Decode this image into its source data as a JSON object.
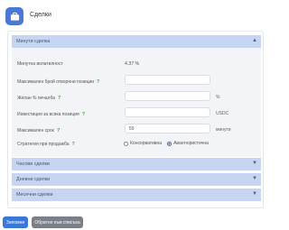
{
  "header": {
    "title": "Сделки"
  },
  "sections": {
    "closed": {
      "title": "Минути сделка"
    },
    "hourly": {
      "title": "Часови сделки"
    },
    "daily": {
      "title": "Дневни сделки"
    },
    "monthly": {
      "title": "Месечни сделки"
    }
  },
  "form": {
    "volatility": {
      "label": "Минутна волатилност",
      "value": "4.37 %"
    },
    "max_positions": {
      "label": "Максимален брой отворени позиции",
      "value": ""
    },
    "profit_pct": {
      "label": "Желан % печалба",
      "value": "",
      "unit": "%"
    },
    "investment": {
      "label": "Инвестиция за всяка позиция",
      "value": "",
      "unit": "USDC"
    },
    "max_duration": {
      "label": "Максимален срок",
      "value": "59",
      "unit": "минути"
    },
    "strategy": {
      "label": "Стратегия при продажба",
      "options": [
        "Консервативна",
        "Авантюристична"
      ],
      "selected": "Авантюристична"
    }
  },
  "buttons": {
    "save": "Запомни",
    "back": "Обратно към списъка"
  },
  "colors": {
    "accent": "#3a77d6",
    "section_header": "#c6d5f2",
    "help": "#4caf50"
  }
}
